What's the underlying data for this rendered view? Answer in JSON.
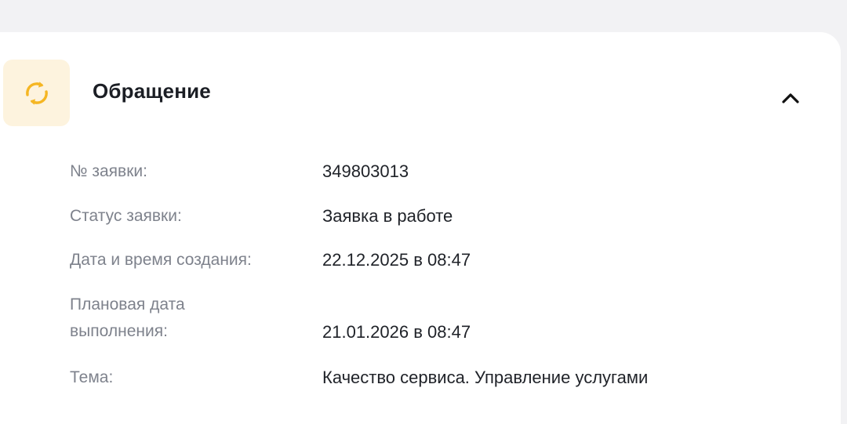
{
  "card": {
    "title": "Обращение",
    "icon": "refresh-icon",
    "toggle_icon": "chevron-up-icon",
    "accent_color": "#f5b623",
    "icon_bg_color": "#fdf3de"
  },
  "fields": [
    {
      "label": "№ заявки:",
      "value": "349803013"
    },
    {
      "label": "Статус заявки:",
      "value": "Заявка в работе"
    },
    {
      "label": "Дата и время создания:",
      "value": "22.12.2025 в 08:47"
    },
    {
      "label_line1": "Плановая дата",
      "label_line2": "выполнения:",
      "value": "21.01.2026 в 08:47"
    },
    {
      "label": "Тема:",
      "value": "Качество сервиса. Управление услугами"
    }
  ]
}
